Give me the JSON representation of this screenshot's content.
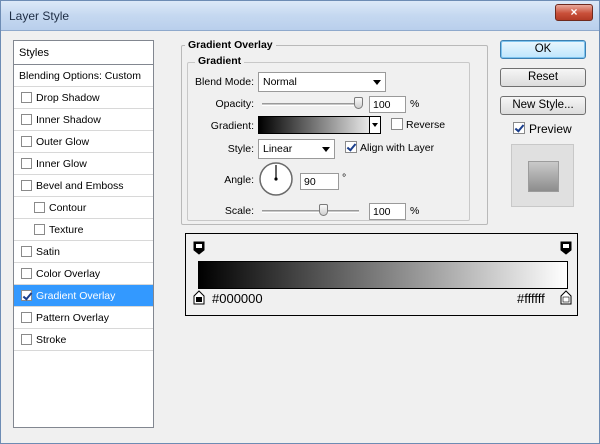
{
  "window": {
    "title": "Layer Style",
    "close_glyph": "×"
  },
  "styles_panel": {
    "header": "Styles",
    "items": [
      {
        "label": "Blending Options: Custom",
        "checkbox": false,
        "checked": false,
        "indent": false,
        "selected": false
      },
      {
        "label": "Drop Shadow",
        "checkbox": true,
        "checked": false,
        "indent": false,
        "selected": false
      },
      {
        "label": "Inner Shadow",
        "checkbox": true,
        "checked": false,
        "indent": false,
        "selected": false
      },
      {
        "label": "Outer Glow",
        "checkbox": true,
        "checked": false,
        "indent": false,
        "selected": false
      },
      {
        "label": "Inner Glow",
        "checkbox": true,
        "checked": false,
        "indent": false,
        "selected": false
      },
      {
        "label": "Bevel and Emboss",
        "checkbox": true,
        "checked": false,
        "indent": false,
        "selected": false
      },
      {
        "label": "Contour",
        "checkbox": true,
        "checked": false,
        "indent": true,
        "selected": false
      },
      {
        "label": "Texture",
        "checkbox": true,
        "checked": false,
        "indent": true,
        "selected": false
      },
      {
        "label": "Satin",
        "checkbox": true,
        "checked": false,
        "indent": false,
        "selected": false
      },
      {
        "label": "Color Overlay",
        "checkbox": true,
        "checked": false,
        "indent": false,
        "selected": false
      },
      {
        "label": "Gradient Overlay",
        "checkbox": true,
        "checked": true,
        "indent": false,
        "selected": true
      },
      {
        "label": "Pattern Overlay",
        "checkbox": true,
        "checked": false,
        "indent": false,
        "selected": false
      },
      {
        "label": "Stroke",
        "checkbox": true,
        "checked": false,
        "indent": false,
        "selected": false
      }
    ]
  },
  "gradient_overlay": {
    "section_title": "Gradient Overlay",
    "subsection_title": "Gradient",
    "blend_mode": {
      "label": "Blend Mode:",
      "value": "Normal"
    },
    "opacity": {
      "label": "Opacity:",
      "value": "100",
      "unit": "%",
      "level": 100
    },
    "gradient": {
      "label": "Gradient:",
      "reverse_label": "Reverse",
      "reverse_checked": false
    },
    "style": {
      "label": "Style:",
      "value": "Linear",
      "align_label": "Align with Layer",
      "align_checked": true
    },
    "angle": {
      "label": "Angle:",
      "value": "90",
      "unit": "°"
    },
    "scale": {
      "label": "Scale:",
      "value": "100",
      "unit": "%",
      "level": 100
    }
  },
  "buttons": {
    "ok": "OK",
    "reset": "Reset",
    "new_style": "New Style..."
  },
  "preview": {
    "label": "Preview",
    "checked": true
  },
  "gradient_editor": {
    "start_color": "#000000",
    "end_color": "#ffffff"
  },
  "colors": {
    "selection": "#3399ff",
    "gradient_start": "#000000",
    "gradient_end": "#ffffff"
  }
}
